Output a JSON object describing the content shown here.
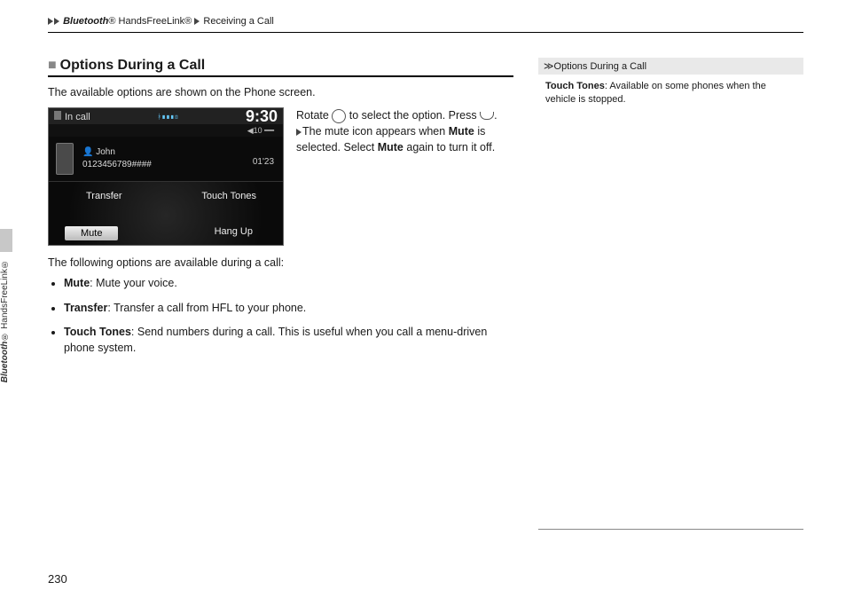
{
  "breadcrumb": {
    "l1": "Bluetooth",
    "l1_suffix": "® HandsFreeLink®",
    "l2": "Receiving a Call"
  },
  "section": {
    "title": "Options During a Call",
    "intro": "The available options are shown on the Phone screen.",
    "aside_rotate_pre": "Rotate ",
    "aside_rotate_post": " to select the option. Press ",
    "aside_rotate_end": ".",
    "aside_mute_1": "The mute icon appears when ",
    "aside_mute_b1": "Mute",
    "aside_mute_2": " is selected. Select ",
    "aside_mute_b2": "Mute",
    "aside_mute_3": " again to turn it off.",
    "list_lead": "The following options are available during a call:",
    "items": [
      {
        "term": "Mute",
        "desc": ": Mute your voice."
      },
      {
        "term": "Transfer",
        "desc": ": Transfer a call from HFL to your phone."
      },
      {
        "term": "Touch Tones",
        "desc": ": Send numbers during a call. This is useful when you call a menu-driven phone system."
      }
    ]
  },
  "screenshot": {
    "status": "In call",
    "clock": "9:30",
    "vol": "10",
    "caller_name": "John",
    "caller_num": "0123456789####",
    "duration": "01'23",
    "opt_tl": "Transfer",
    "opt_tr": "Touch Tones",
    "opt_bl": "Mute",
    "opt_br": "Hang Up"
  },
  "sidebar": {
    "title": "Options During a Call",
    "note_b": "Touch Tones",
    "note": ": Available on some phones when the vehicle is stopped."
  },
  "margin": {
    "l1": "Bluetooth",
    "l2": "® HandsFreeLink®"
  },
  "page_number": "230"
}
